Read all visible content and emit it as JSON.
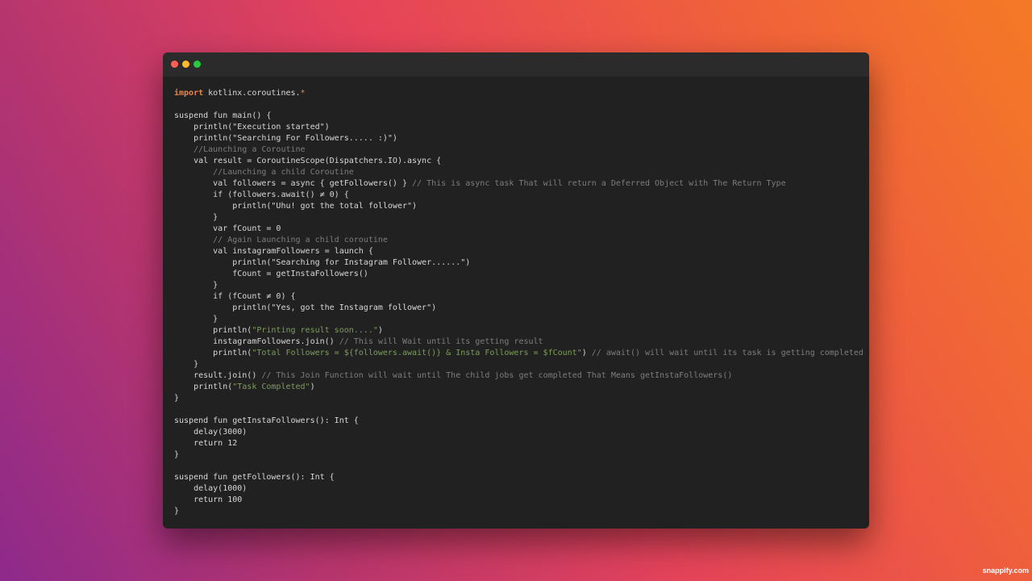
{
  "window": {
    "controls": [
      "close",
      "minimize",
      "maximize"
    ]
  },
  "code": {
    "language": "kotlin",
    "lines": [
      [
        {
          "t": "import",
          "c": "kw"
        },
        {
          "t": " kotlinx.coroutines."
        },
        {
          "t": "*",
          "c": "op"
        }
      ],
      [],
      [
        {
          "t": "suspend fun main() {"
        }
      ],
      [
        {
          "t": "    println(\"Execution started\")"
        }
      ],
      [
        {
          "t": "    println(\"Searching For Followers..... :)\")"
        }
      ],
      [
        {
          "t": "    //Launching a Coroutine",
          "c": "cm"
        }
      ],
      [
        {
          "t": "    val result = CoroutineScope(Dispatchers.IO).async {"
        }
      ],
      [
        {
          "t": "        //Launching a child Coroutine",
          "c": "cm"
        }
      ],
      [
        {
          "t": "        val followers = async { getFollowers() } "
        },
        {
          "t": "// This is async task That will return a Deferred Object with The Return Type",
          "c": "cm"
        }
      ],
      [
        {
          "t": "        if (followers.await() ≠ 0) {"
        }
      ],
      [
        {
          "t": "            println(\"Uhu! got the total follower\")"
        }
      ],
      [
        {
          "t": "        }"
        }
      ],
      [
        {
          "t": "        var fCount = 0"
        }
      ],
      [
        {
          "t": "        // Again Launching a child coroutine",
          "c": "cm"
        }
      ],
      [
        {
          "t": "        val instagramFollowers = launch {"
        }
      ],
      [
        {
          "t": "            println(\"Searching for Instagram Follower......\")"
        }
      ],
      [
        {
          "t": "            fCount = getInstaFollowers()"
        }
      ],
      [
        {
          "t": "        }"
        }
      ],
      [
        {
          "t": "        if (fCount ≠ 0) {"
        }
      ],
      [
        {
          "t": "            println(\"Yes, got the Instagram follower\")"
        }
      ],
      [
        {
          "t": "        }"
        }
      ],
      [
        {
          "t": "        println("
        },
        {
          "t": "\"Printing result soon....\"",
          "c": "str"
        },
        {
          "t": ")"
        }
      ],
      [
        {
          "t": "        instagramFollowers.join() "
        },
        {
          "t": "// This will Wait until its getting result",
          "c": "cm"
        }
      ],
      [
        {
          "t": "        println("
        },
        {
          "t": "\"Total Followers = ${followers.await()} & Insta Followers = $fCount\"",
          "c": "str"
        },
        {
          "t": ") "
        },
        {
          "t": "// await() will wait until its task is getting completed",
          "c": "cm"
        }
      ],
      [
        {
          "t": "    }"
        }
      ],
      [
        {
          "t": "    result.join() "
        },
        {
          "t": "// This Join Function will wait until The child jobs get completed That Means getInstaFollowers()",
          "c": "cm"
        }
      ],
      [
        {
          "t": "    println("
        },
        {
          "t": "\"Task Completed\"",
          "c": "str"
        },
        {
          "t": ")"
        }
      ],
      [
        {
          "t": "}"
        }
      ],
      [],
      [
        {
          "t": "suspend fun getInstaFollowers(): Int {"
        }
      ],
      [
        {
          "t": "    delay(3000)"
        }
      ],
      [
        {
          "t": "    return 12"
        }
      ],
      [
        {
          "t": "}"
        }
      ],
      [],
      [
        {
          "t": "suspend fun getFollowers(): Int {"
        }
      ],
      [
        {
          "t": "    delay(1000)"
        }
      ],
      [
        {
          "t": "    return 100"
        }
      ],
      [
        {
          "t": "}"
        }
      ]
    ]
  },
  "watermark": "snappify.com",
  "colors": {
    "keyword": "#e8864a",
    "comment": "#7d7d7d",
    "string": "#7c9d5a",
    "text": "#d8d8d8",
    "editor_bg": "#212121"
  }
}
